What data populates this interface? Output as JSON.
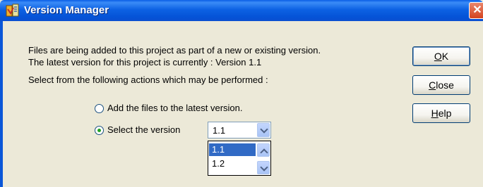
{
  "window": {
    "title": "Version Manager",
    "close_glyph": "✕"
  },
  "message": {
    "line1": "Files are being added to this project as part of a new or existing version.",
    "line2": "The latest version for this project is currently : Version 1.1",
    "line3": "Select from the following actions which may be performed :"
  },
  "buttons": {
    "ok_label_u": "O",
    "ok_label_rest": "K",
    "close_label_u": "C",
    "close_label_rest": "lose",
    "help_label_u": "H",
    "help_label_rest": "elp"
  },
  "options": {
    "add_latest_label": "Add the files to the latest version.",
    "select_version_label": "Select the version",
    "selected": "select_version"
  },
  "version_combo": {
    "value": "1.1",
    "items": [
      "1.1",
      "1.2"
    ],
    "highlighted": "1.1"
  },
  "icons": {
    "app": "version-manager-app-icon",
    "close": "close-icon",
    "dropdown": "chevron-down-icon",
    "scroll_up": "chevron-up-icon",
    "scroll_down": "chevron-down-icon"
  }
}
